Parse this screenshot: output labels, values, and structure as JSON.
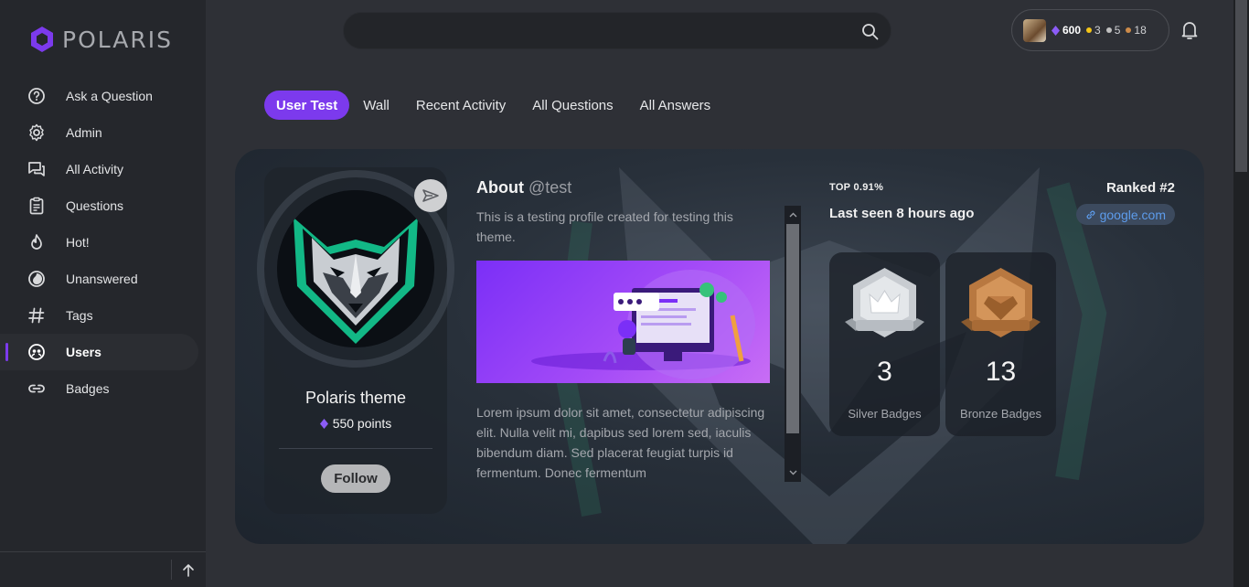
{
  "app": {
    "logo_text": "POLARIS"
  },
  "sidebar": {
    "items": [
      {
        "label": "Ask a Question",
        "icon": "question-circle-icon"
      },
      {
        "label": "Admin",
        "icon": "gear-icon"
      },
      {
        "label": "All Activity",
        "icon": "chat-bubbles-icon"
      },
      {
        "label": "Questions",
        "icon": "clipboard-icon"
      },
      {
        "label": "Hot!",
        "icon": "flame-icon"
      },
      {
        "label": "Unanswered",
        "icon": "half-circle-icon"
      },
      {
        "label": "Tags",
        "icon": "hash-icon"
      },
      {
        "label": "Users",
        "icon": "users-icon",
        "active": true
      },
      {
        "label": "Badges",
        "icon": "link-icon"
      }
    ]
  },
  "search": {
    "placeholder": ""
  },
  "user_chip": {
    "reputation": "600",
    "gold": "3",
    "silver": "5",
    "bronze": "18"
  },
  "colors": {
    "accent": "#7c3aed",
    "gold": "#f5c518",
    "silver": "#c0c0c0",
    "bronze": "#cd8b4a",
    "link": "#5d9cec"
  },
  "tabs": [
    {
      "label": "User Test",
      "active": true
    },
    {
      "label": "Wall"
    },
    {
      "label": "Recent Activity"
    },
    {
      "label": "All Questions"
    },
    {
      "label": "All Answers"
    }
  ],
  "profile": {
    "name": "Polaris theme",
    "points": "550 points",
    "follow_label": "Follow",
    "about_label": "About",
    "handle": "@test",
    "about_text": "This is a testing profile created for testing this theme.",
    "lorem": "Lorem ipsum dolor sit amet, consectetur adipiscing elit. Nulla velit mi, dapibus sed lorem sed, iaculis bibendum diam. Sed placerat feugiat turpis id fermentum. Donec fermentum",
    "top_percent": "TOP 0.91%",
    "last_seen": "Last seen 8 hours ago",
    "ranked": "Ranked #2",
    "website": "google.com",
    "badges": [
      {
        "count": "3",
        "label": "Silver Badges",
        "kind": "silver"
      },
      {
        "count": "13",
        "label": "Bronze Badges",
        "kind": "bronze"
      }
    ]
  }
}
